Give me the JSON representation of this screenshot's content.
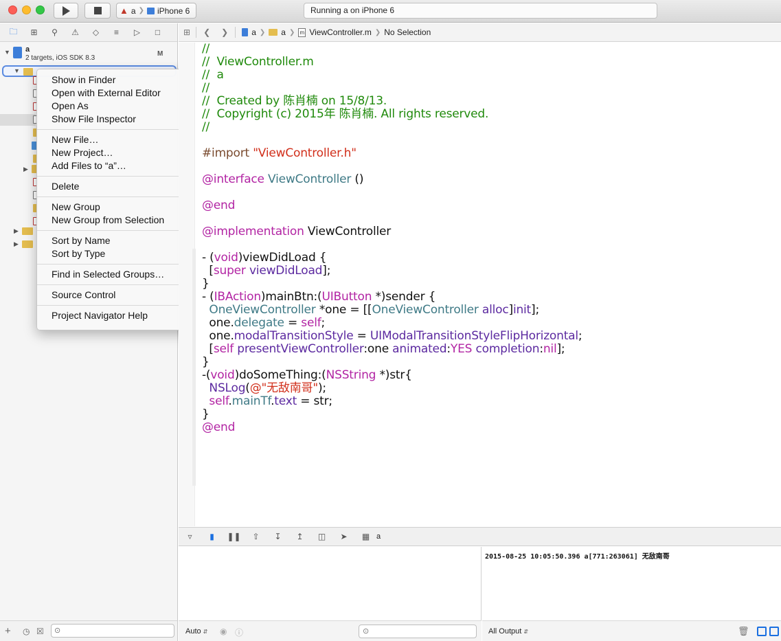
{
  "titlebar": {
    "scheme_name": "a",
    "device": "iPhone 6",
    "status": "Running a on iPhone 6"
  },
  "navigator": {
    "project": {
      "name": "a",
      "subtitle": "2 targets, iOS SDK 8.3",
      "badge": "M"
    },
    "group_label": "a"
  },
  "context_menu": {
    "groups": [
      [
        "Show in Finder",
        "Open with External Editor",
        "Open As",
        "Show File Inspector"
      ],
      [
        "New File...",
        "New Project...",
        "Add Files to “a”..."
      ],
      [
        "Delete"
      ],
      [
        "New Group",
        "New Group from Selection"
      ],
      [
        "Sort by Name",
        "Sort by Type"
      ],
      [
        "Find in Selected Groups..."
      ],
      [
        "Source Control"
      ],
      [
        "Project Navigator Help"
      ]
    ],
    "show_in_finder": "Show in Finder",
    "open_external": "Open with External Editor",
    "open_as": "Open As",
    "show_inspector": "Show File Inspector",
    "new_file": "New File…",
    "new_project": "New Project…",
    "add_files": "Add Files to “a”…",
    "delete": "Delete",
    "new_group": "New Group",
    "new_group_sel": "New Group from Selection",
    "sort_name": "Sort by Name",
    "sort_type": "Sort by Type",
    "find_groups": "Find in Selected Groups…",
    "source_control": "Source Control",
    "nav_help": "Project Navigator Help"
  },
  "jump_bar": {
    "project": "a",
    "group": "a",
    "file": "ViewController.m",
    "selection": "No Selection"
  },
  "debug": {
    "process": "a",
    "var_popup": "Auto",
    "console_popup": "All Output",
    "console_output": "2015-08-25 10:05:50.396 a[771:263061] 无敌南哥"
  },
  "colors": {
    "comment": "#208a0c",
    "keyword": "#b224a3",
    "string": "#d12f1b",
    "class": "#3f7a86",
    "accent": "#1a6fe0"
  }
}
